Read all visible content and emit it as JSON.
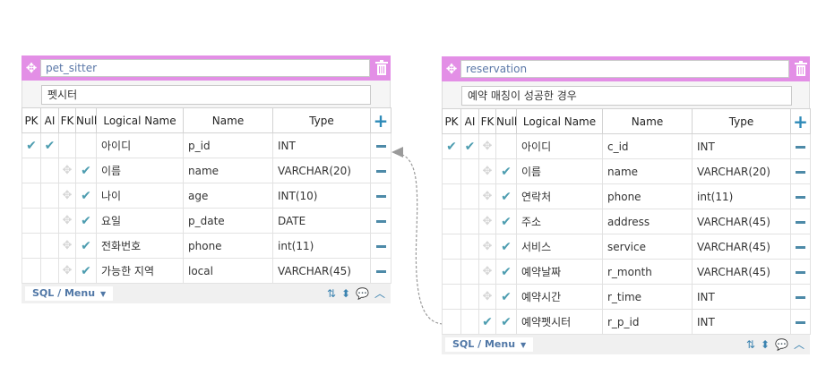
{
  "columns_header": {
    "pk": "PK",
    "ai": "AI",
    "fk": "FK",
    "null": "Null",
    "logical": "Logical Name",
    "name": "Name",
    "type": "Type"
  },
  "footer": {
    "sql_menu": "SQL / Menu"
  },
  "colors": {
    "header": "#e38fe6",
    "check": "#4d9db0",
    "accent": "#2e8ab8"
  },
  "tables": [
    {
      "name": "pet_sitter",
      "comment": "펫시터",
      "rows": [
        {
          "pk": true,
          "ai": true,
          "fk": false,
          "nn": false,
          "logical": "아이디",
          "name": "p_id",
          "type": "INT"
        },
        {
          "pk": false,
          "ai": false,
          "fk": false,
          "nn": true,
          "logical": "이름",
          "name": "name",
          "type": "VARCHAR(20)"
        },
        {
          "pk": false,
          "ai": false,
          "fk": false,
          "nn": true,
          "logical": "나이",
          "name": "age",
          "type": "INT(10)"
        },
        {
          "pk": false,
          "ai": false,
          "fk": false,
          "nn": true,
          "logical": "요일",
          "name": "p_date",
          "type": "DATE"
        },
        {
          "pk": false,
          "ai": false,
          "fk": false,
          "nn": true,
          "logical": "전화번호",
          "name": "phone",
          "type": "int(11)"
        },
        {
          "pk": false,
          "ai": false,
          "fk": false,
          "nn": true,
          "logical": "가능한 지역",
          "name": "local",
          "type": "VARCHAR(45)"
        }
      ]
    },
    {
      "name": "reservation",
      "comment": "예약 매칭이 성공한 경우",
      "rows": [
        {
          "pk": true,
          "ai": true,
          "fk": false,
          "nn": false,
          "logical": "아이디",
          "name": "c_id",
          "type": "INT"
        },
        {
          "pk": false,
          "ai": false,
          "fk": false,
          "nn": true,
          "logical": "이름",
          "name": "name",
          "type": "VARCHAR(20)"
        },
        {
          "pk": false,
          "ai": false,
          "fk": false,
          "nn": true,
          "logical": "연락처",
          "name": "phone",
          "type": "int(11)"
        },
        {
          "pk": false,
          "ai": false,
          "fk": false,
          "nn": true,
          "logical": "주소",
          "name": "address",
          "type": "VARCHAR(45)"
        },
        {
          "pk": false,
          "ai": false,
          "fk": false,
          "nn": true,
          "logical": "서비스",
          "name": "service",
          "type": "VARCHAR(45)"
        },
        {
          "pk": false,
          "ai": false,
          "fk": false,
          "nn": true,
          "logical": "예약날짜",
          "name": "r_month",
          "type": "VARCHAR(45)"
        },
        {
          "pk": false,
          "ai": false,
          "fk": false,
          "nn": true,
          "logical": "예약시간",
          "name": "r_time",
          "type": "INT"
        },
        {
          "pk": false,
          "ai": false,
          "fk": true,
          "nn": true,
          "logical": "예약펫시터",
          "name": "r_p_id",
          "type": "INT"
        }
      ]
    }
  ]
}
